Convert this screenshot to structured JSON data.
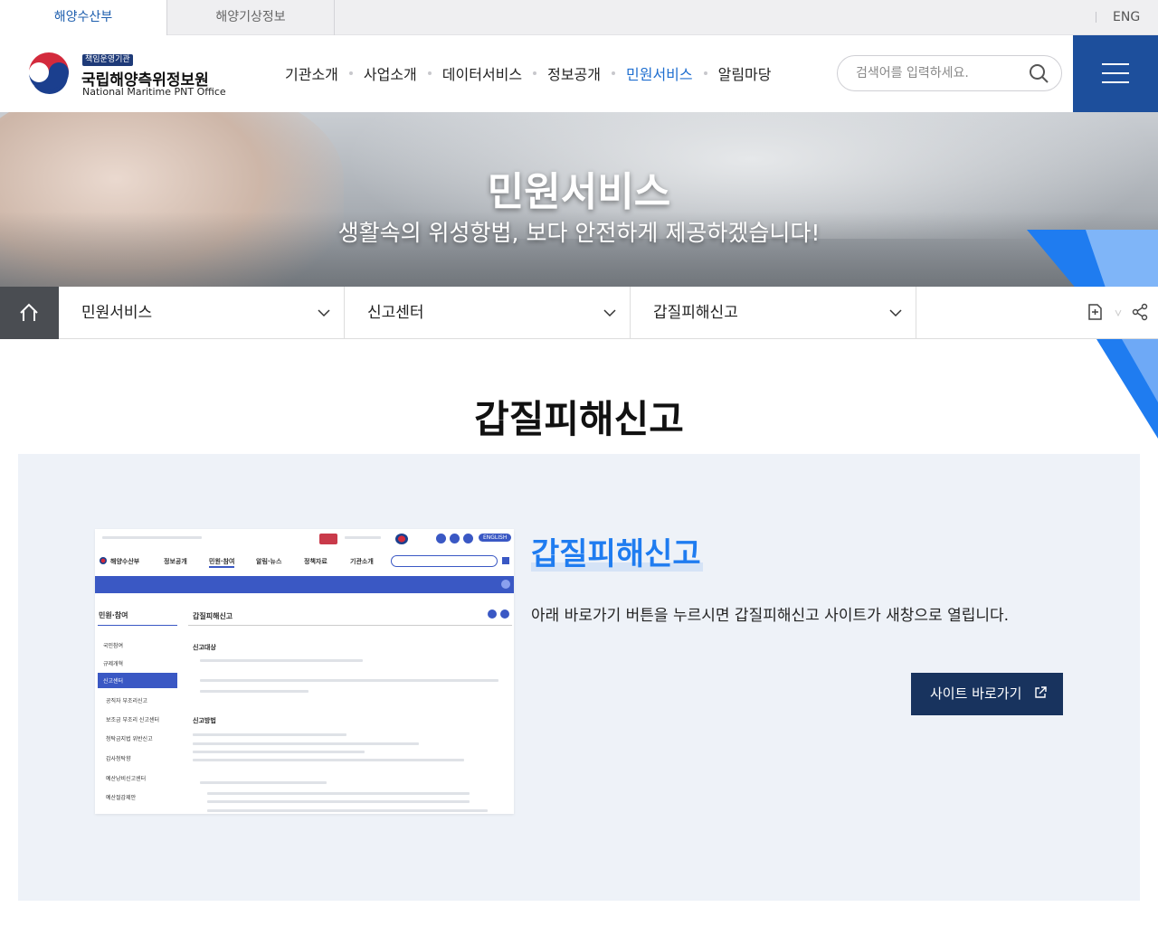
{
  "topbar": {
    "tabs": [
      "해양수산부",
      "해양기상정보"
    ],
    "lang": "ENG"
  },
  "header": {
    "badge": "책임운영기관",
    "org_name_ko": "국립해양측위정보원",
    "org_name_en": "National Maritime PNT Office",
    "nav": [
      "기관소개",
      "사업소개",
      "데이터서비스",
      "정보공개",
      "민원서비스",
      "알림마당"
    ],
    "active_nav": "민원서비스",
    "search_placeholder": "검색어를 입력하세요."
  },
  "hero": {
    "title": "민원서비스",
    "subtitle": "생활속의 위성항법, 보다 안전하게 제공하겠습니다!"
  },
  "location": {
    "level1": "민원서비스",
    "level2": "신고센터",
    "level3": "갑질피해신고"
  },
  "content": {
    "page_title": "갑질피해신고",
    "info_title": "갑질피해신고",
    "info_desc": "아래 바로가기 버튼을 누르시면 갑질피해신고 사이트가 새창으로 열립니다.",
    "button_label": "사이트 바로가기"
  },
  "preview": {
    "logo": "해양수산부",
    "nav": [
      "정보공개",
      "민원·참여",
      "알림·뉴스",
      "정책자료",
      "기관소개"
    ],
    "english_badge": "ENGLISH",
    "sidebar_title": "민원·참여",
    "main_title": "갑질피해신고",
    "sidebar_items": [
      "국민참여",
      "규제개혁",
      "신고센터",
      "공직자 부조리신고",
      "보조금 부조리 신고센터",
      "청탁금지법 위반신고",
      "갑사청탁향",
      "예산낭비신고센터",
      "예산절감제안"
    ],
    "section1": "신고대상",
    "section2": "신고방법"
  },
  "colors": {
    "primary_navy": "#1d4f9c",
    "accent_blue": "#1f7cf0",
    "button_dark": "#18335e",
    "panel_bg": "#eef2f8"
  }
}
